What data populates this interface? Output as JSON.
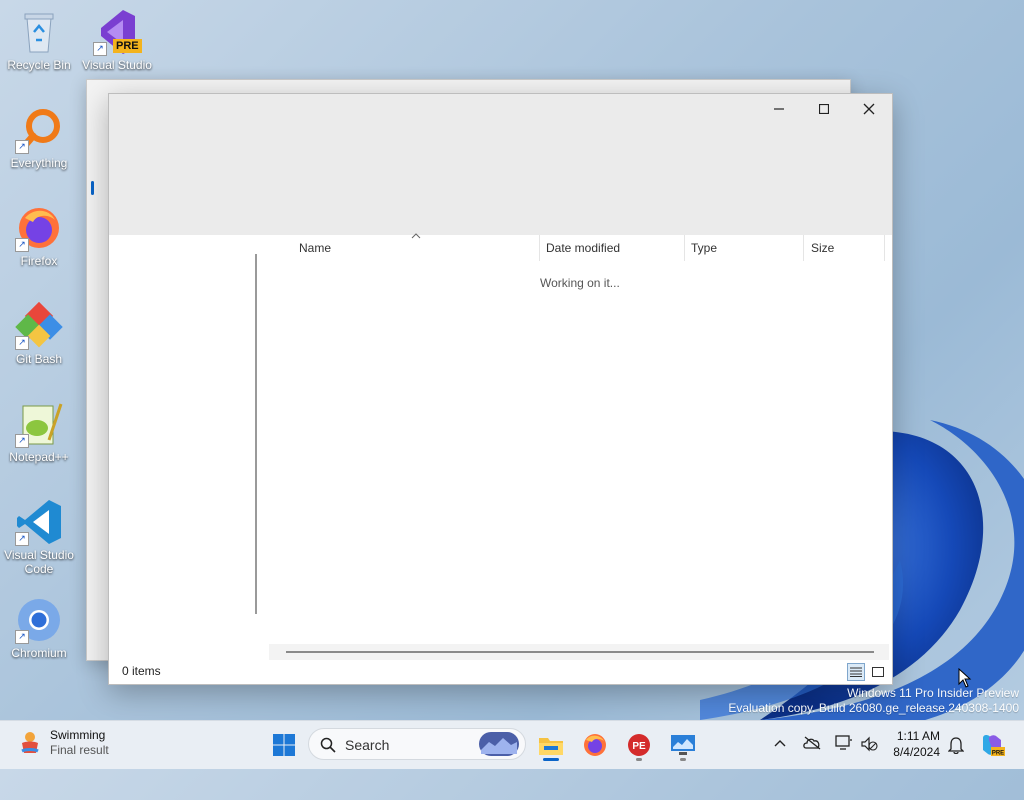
{
  "desktop": {
    "icons": [
      {
        "label": "Recycle Bin",
        "icon": "recycle-bin-icon"
      },
      {
        "label": "Visual Studio",
        "icon": "visual-studio-preview-icon",
        "badge": "PRE"
      },
      {
        "label": "Everything",
        "icon": "everything-search-icon"
      },
      {
        "label": "Firefox",
        "icon": "firefox-icon"
      },
      {
        "label": "Git Bash",
        "icon": "git-bash-icon"
      },
      {
        "label": "Notepad++",
        "icon": "notepad-plus-plus-icon"
      },
      {
        "label": "Visual Studio Code",
        "icon": "vscode-icon"
      },
      {
        "label": "Chromium",
        "icon": "chromium-icon"
      }
    ],
    "watermark": {
      "line1": "Windows 11 Pro Insider Preview",
      "line2": "Evaluation copy. Build 26080.ge_release.240308-1400"
    }
  },
  "explorer": {
    "columns": [
      "Name",
      "Date modified",
      "Type",
      "Size"
    ],
    "loading_text": "Working on it...",
    "status": "0 items",
    "controls": {
      "minimize": "minimize-icon",
      "maximize": "maximize-icon",
      "close": "close-icon"
    }
  },
  "taskbar": {
    "weather": {
      "title": "Swimming",
      "subtitle": "Final result"
    },
    "search_placeholder": "Search",
    "apps": [
      "start",
      "search",
      "file-explorer",
      "firefox",
      "process-explorer",
      "remote-desktop"
    ],
    "clock": {
      "time": "1:11 AM",
      "date": "8/4/2024"
    }
  },
  "colors": {
    "accent": "#0a64c8",
    "taskbar": "#e9eef4",
    "titlebar": "#ebebeb"
  }
}
